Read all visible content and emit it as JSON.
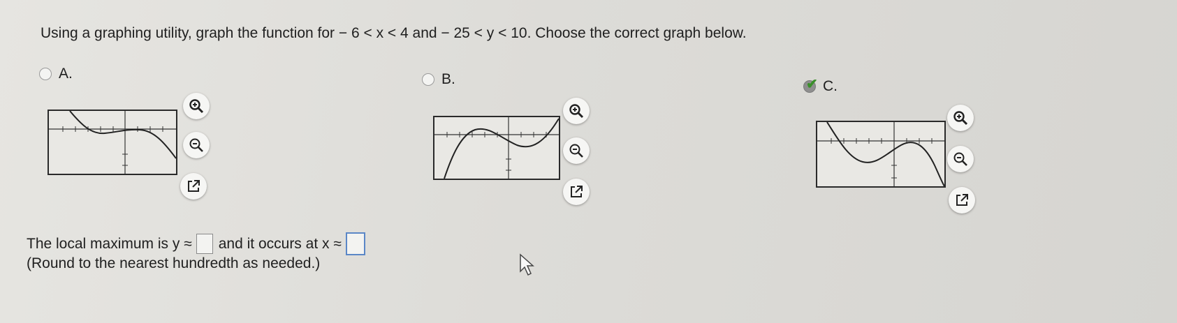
{
  "question": {
    "text": "Using a graphing utility, graph the function for  − 6 < x < 4  and  − 25 < y < 10. Choose the correct graph below."
  },
  "options": [
    {
      "label": "A.",
      "selected": false
    },
    {
      "label": "B.",
      "selected": false
    },
    {
      "label": "C.",
      "selected": true
    }
  ],
  "tools": {
    "zoom_in_icon": "zoom-in-icon",
    "zoom_out_icon": "zoom-out-icon",
    "popout_icon": "external-link-icon"
  },
  "answer": {
    "part1": "The local maximum is y ≈",
    "part2": "and it occurs at x ≈",
    "y_value": "",
    "x_value": "",
    "note": "(Round to the nearest hundredth as needed.)"
  },
  "colors": {
    "check": "#3a8f2a",
    "active_input_border": "#5b87c7"
  }
}
